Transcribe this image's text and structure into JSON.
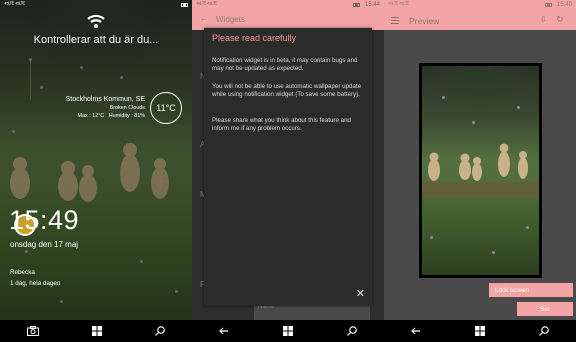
{
  "lockscreen": {
    "status": {
      "signal": "⁴⁵ᴸᵀᴱ ⁴⁵ᴸᵀᴱ",
      "time": "",
      "battery": ""
    },
    "notification": "Kontrollerar att du är du...",
    "weather": {
      "location": "Stockholms Kommun, SE",
      "condition": "Broken Clouds",
      "max": "Max : 12°C",
      "humidity": "Humidity : 81%",
      "temperature": "11°C"
    },
    "clock": "15:49",
    "date": "onsdag den 17 maj",
    "calendar": {
      "name": "Rebecka",
      "detail": "1 dag, hela dagen"
    }
  },
  "settings": {
    "status": {
      "time": "15:44"
    },
    "title": "Widgets",
    "dialog": {
      "title": "Please read carefully",
      "para1": "Notification widget is in beta, it may contain bugs and may not be updated as expected.",
      "para2": "You will not be able to use automatic wallpaper update while using notification widget (To save some battery).",
      "para3": "Please share what you think about this feature and inform me if any problem occurs.",
      "close": "✕"
    },
    "ghost_field": "Name"
  },
  "preview": {
    "status": {
      "time": "15:40"
    },
    "title": "Preview",
    "lock_screen_button": "Lock screen",
    "set_button": "Set"
  },
  "colors": {
    "accent_pink": "#f3a5a5",
    "dialog_title": "#f39a9a",
    "dark_panel": "#4a4a4a"
  },
  "icons": [
    "wifi-icon",
    "camera-icon",
    "windows-icon",
    "search-icon",
    "back-icon",
    "hamburger-icon",
    "share-icon",
    "refresh-icon",
    "close-icon"
  ]
}
